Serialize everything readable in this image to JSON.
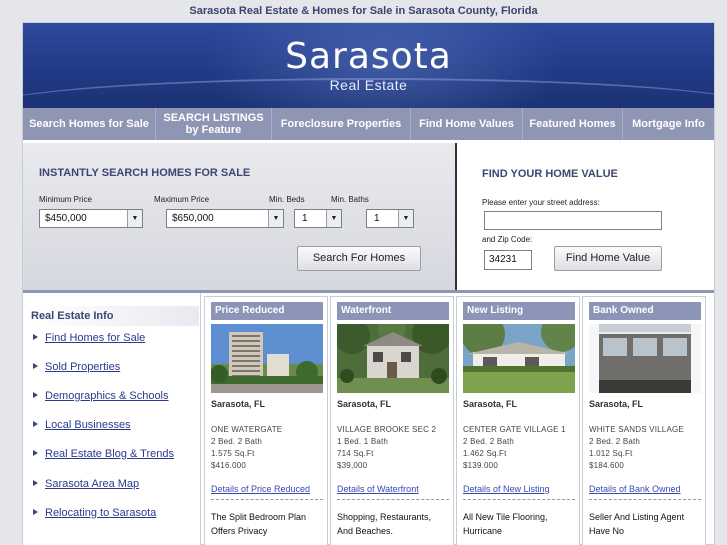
{
  "page_title": "Sarasota Real Estate & Homes for Sale in Sarasota County, Florida",
  "brand": {
    "name": "Sarasota",
    "tagline": "Real Estate"
  },
  "nav": [
    {
      "label": "Search Homes for Sale"
    },
    {
      "label": "SEARCH LISTINGS",
      "sub": "by Feature"
    },
    {
      "label": "Foreclosure Properties"
    },
    {
      "label": "Find Home Values"
    },
    {
      "label": "Featured Homes"
    },
    {
      "label": "Mortgage Info"
    }
  ],
  "search": {
    "title": "INSTANTLY SEARCH HOMES FOR SALE",
    "min_price_label": "Minimum Price",
    "min_price_value": "$450,000",
    "max_price_label": "Maximum Price",
    "max_price_value": "$650,000",
    "min_beds_label": "Min. Beds",
    "min_beds_value": "1",
    "min_baths_label": "Min. Baths",
    "min_baths_value": "1",
    "button": "Search For Homes"
  },
  "home_value": {
    "title": "FIND YOUR HOME VALUE",
    "address_label": "Please enter your street address:",
    "address_value": "",
    "zip_label": "and Zip Code:",
    "zip_value": "34231",
    "button": "Find Home Value"
  },
  "sidebar": {
    "title": "Real Estate Info",
    "items": [
      "Find Homes for Sale",
      "Sold Properties",
      "Demographics & Schools",
      "Local Businesses",
      "Real Estate Blog & Trends",
      "Sarasota Area Map",
      "Relocating to Sarasota"
    ]
  },
  "listings": [
    {
      "tag": "Price Reduced",
      "city": "Sarasota, FL",
      "name": "ONE WATERGATE",
      "rooms": "2 Bed. 2 Bath",
      "sqft": "1.575 Sq.Ft",
      "price": "$416.000",
      "link": "Details of Price Reduced",
      "desc1": "The Split Bedroom Plan",
      "desc2": "Offers Privacy"
    },
    {
      "tag": "Waterfront",
      "city": "Sarasota, FL",
      "name": "VILLAGE BROOKE SEC 2",
      "rooms": "1 Bed. 1 Bath",
      "sqft": "714 Sq.Ft",
      "price": "$39,000",
      "link": "Details of Waterfront",
      "desc1": "Shopping, Restaurants,",
      "desc2": "And Beaches."
    },
    {
      "tag": "New Listing",
      "city": "Sarasota, FL",
      "name": "CENTER GATE VILLAGE 1",
      "rooms": "2 Bed. 2 Bath",
      "sqft": "1.462 Sq.Ft",
      "price": "$139.000",
      "link": "Details of New Listing",
      "desc1": "All New Tile Flooring,",
      "desc2": "Hurricane"
    },
    {
      "tag": "Bank Owned",
      "city": "Sarasota, FL",
      "name": "WHITE SANDS VILLAGE",
      "rooms": "2 Bed. 2 Bath",
      "sqft": "1.012 Sq.Ft",
      "price": "$184.600",
      "link": "Details of Bank Owned",
      "desc1": "Seller And Listing Agent",
      "desc2": "Have No"
    }
  ],
  "colors": {
    "brand_blue": "#223a86",
    "nav_bar": "#8f96b4",
    "heading": "#3d4672",
    "link": "#2a3a8e"
  }
}
